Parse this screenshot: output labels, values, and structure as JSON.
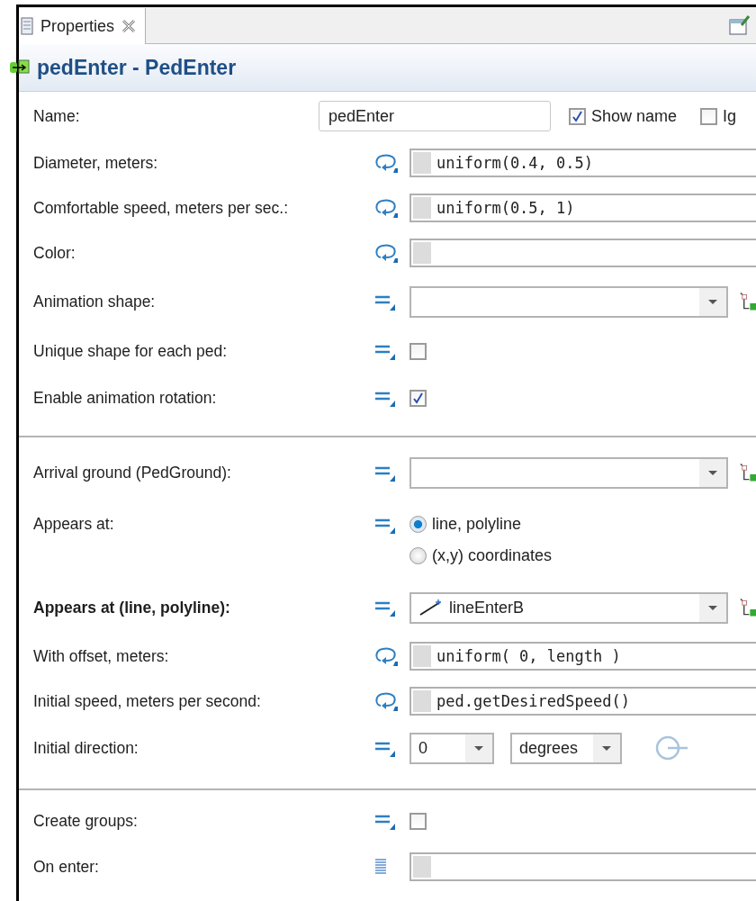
{
  "tab": {
    "title": "Properties",
    "selected": true
  },
  "header": {
    "title": "pedEnter - PedEnter"
  },
  "sections": [
    {
      "rows": [
        {
          "kind": "name",
          "label": "Name:",
          "value": "pedEnter",
          "options": [
            {
              "label": "Show name",
              "checked": true
            },
            {
              "label": "Ig",
              "checked": false
            }
          ]
        },
        {
          "kind": "code",
          "editor": {
            "kind": "dynamic"
          },
          "label": "Diameter, meters:",
          "value": "uniform(0.4, 0.5)"
        },
        {
          "kind": "code",
          "editor": {
            "kind": "dynamic"
          },
          "label": "Comfortable speed, meters per sec.:",
          "value": "uniform(0.5, 1)"
        },
        {
          "kind": "code",
          "editor": {
            "kind": "dynamic"
          },
          "label": "Color:"
        },
        {
          "kind": "dropdown",
          "editor": {
            "kind": "static"
          },
          "label": "Animation shape:"
        },
        {
          "kind": "checkbox",
          "editor": {
            "kind": "static"
          },
          "label": "Unique shape for each ped:",
          "checked": false
        },
        {
          "kind": "checkbox",
          "editor": {
            "kind": "static"
          },
          "label": "Enable animation rotation:",
          "checked": true
        }
      ]
    },
    {
      "rows": [
        {
          "kind": "dropdown",
          "editor": {
            "kind": "static"
          },
          "label": "Arrival ground (PedGround):"
        },
        {
          "kind": "radio",
          "editor": {
            "kind": "static"
          },
          "label": "Appears at:",
          "options": [
            {
              "label": "line, polyline",
              "selected": true
            },
            {
              "label": "(x,y) coordinates",
              "selected": false
            }
          ]
        },
        {
          "kind": "dropdown",
          "editor": {
            "kind": "static"
          },
          "label": "Appears at (line, polyline):",
          "bold": true,
          "value": "lineEnterB"
        },
        {
          "kind": "code",
          "editor": {
            "kind": "dynamic"
          },
          "label": "With offset, meters:",
          "value": "uniform( 0, length )"
        },
        {
          "kind": "code",
          "editor": {
            "kind": "dynamic"
          },
          "label": "Initial speed, meters per second:",
          "value": "ped.getDesiredSpeed()"
        },
        {
          "kind": "direction",
          "editor": {
            "kind": "static"
          },
          "label": "Initial direction:",
          "value": "0",
          "unit": "degrees"
        }
      ]
    },
    {
      "rows": [
        {
          "kind": "checkbox",
          "editor": {
            "kind": "static"
          },
          "label": "Create groups:",
          "checked": false
        },
        {
          "kind": "code",
          "editor": {
            "kind": "action"
          },
          "label": "On enter:"
        }
      ]
    }
  ]
}
